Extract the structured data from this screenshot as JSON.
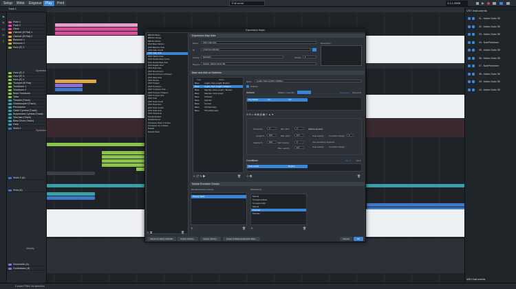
{
  "modes": [
    "Setup",
    "Write",
    "Engrave",
    "Play",
    "Print"
  ],
  "active_mode": "Play",
  "zoom": "Full score",
  "counter": "1.1.1.2908",
  "subtrack": "Track 1",
  "tools": [
    "arrow",
    "pencil",
    "eraser",
    "scissors",
    "glue"
  ],
  "tracks": [
    "Flute 1",
    "Flute 2",
    "Oboe",
    "Clarinet (B Flat) 1",
    "Clarinet (B Flat) 2",
    "Bassoon 1",
    "Bassoon 2",
    "Horn (F) 1",
    "Horn (F) 2",
    "Horn (F) 3",
    "Horn (F) 4",
    "Trumpet (B Flat)",
    "Trombone 1",
    "Trombone 2",
    "Bass Trombone",
    "Tuba",
    "Timpani (Track)",
    "Glockenspiel (Track)",
    "Percussion",
    "Clash Cymbal (Track)",
    "Suspended Cymbal (Track)",
    "Tam-tam (Track)",
    "Bass Drum (Track)",
    "Harp",
    "Violin 1",
    "Violin 2 (A)",
    "Viola (A)",
    "Violoncello (A)",
    "Contrabass (A)"
  ],
  "lane_labels": {
    "dynamics": "Dynamics",
    "velocity": "Velocity"
  },
  "right_panel": {
    "title": "VST Instruments",
    "instruments": [
      "01 - Halion Sonic SE",
      "02 - Halion Sonic SE",
      "03 - Halion Sonic SE",
      "04 - NotePerformer",
      "05 - Halion Sonic SE",
      "06 - Halion Sonic SE",
      "07 - NotePerformer",
      "08 - Halion Sonic SE",
      "09 - Halion Sonic SE",
      "10 - Halion Sonic SE"
    ],
    "footer": "MIDI Instruments"
  },
  "status": [
    "Concert Pitch",
    "No selection"
  ],
  "dialog": {
    "title": "Expression Maps",
    "map_list": [
      "BBCSO Brass",
      "BBCSO Strings",
      "BBCSO Winds",
      "HSO Bass Clarinet",
      "HSO Bassoon Solo",
      "HSO Cello Combi",
      "HSO Cello Solo",
      "HSO Clarinet Solo",
      "HSO Double Bass Combi",
      "HSO Double Bass Solo",
      "HSO English Horn",
      "HSO Flute Solo",
      "HSO French Horn",
      "HSO French Horn 4 Players",
      "HSO Oboe Solo",
      "HSO Piccolo",
      "HSO Timpani",
      "HSO Trombone",
      "HSO Trombone Solo",
      "HSO Trumpet 3 Players",
      "HSO Trumpet Solo",
      "HSO Tuba",
      "HSO Viola Combi",
      "HSO Viola Solo",
      "HSO Violin Combi",
      "HSO Violin Solo",
      "HSO Xylophone",
      "Kontakt Default",
      "NotePerformer",
      "Transpose Down 1 Octave",
      "Transpose Up 1 Octave",
      "Default",
      "Default (Solo)"
    ],
    "selected_map": "HSO Cello Solo",
    "sections": {
      "data": "Expression Map Data",
      "switches": "Base and Add-on Switches",
      "exclusion": "Mutual Exclusion Groups"
    },
    "fields": {
      "name_label": "Name",
      "name_value": "HSO Cello Solo",
      "id_label": "ID",
      "id_value": "xmap.hso.cellosolo",
      "creator_label": "Creator",
      "creator_value": "Steinberg",
      "version_label": "Version",
      "version_value": "1",
      "plugin_label": "Plug-ins",
      "plugin_value": "HALion, HALion Sonic SE",
      "desc_label": "Description"
    },
    "switch_headers": [
      "Type",
      "Name"
    ],
    "switches": [
      [
        "Base",
        "Legato, Note Length, Medium"
      ],
      [
        "Base",
        "Legato, Note Length = Medium"
      ],
      [
        "Base",
        "Staccato, Note Length = Medium"
      ],
      [
        "Base",
        "Staccato, Note Length"
      ],
      [
        "Base",
        "Pizzicato"
      ],
      [
        "Base",
        "Spiccato"
      ],
      [
        "Base",
        "Tremolo"
      ],
      [
        "Base",
        "Trill (half step)"
      ],
      [
        "Base",
        "Trill (whole step)"
      ]
    ],
    "switch_name": "Legato, Note Length = Medium",
    "enabled_label": "Enabled",
    "actions": {
      "title": "Actions",
      "mode_label": "Middle C (note 60)",
      "radio_1": "On events",
      "radio_2": "Off events",
      "ks_label": "Key Switch",
      "ks_value": "C2",
      "ks_vel": "127"
    },
    "transform": {
      "transpose_label": "Transpose",
      "transpose_value": "0",
      "min_pitch_label": "Min. pitch",
      "min_pitch_value": "0",
      "length_label": "Length %",
      "length_value": "100",
      "max_pitch_label": "Max. pitch",
      "max_pitch_value": "127",
      "velocity_label": "Velocity %",
      "velocity_value": "100",
      "min_vel_label": "Min. velocity",
      "min_vel_value": "0",
      "max_vel_label": "Max. velocity",
      "max_vel_value": "127"
    },
    "volume": {
      "title": "Volume dynamic",
      "note_vel": "Note velocity",
      "cc": "Controller change",
      "cc_value": "1",
      "vel_dyn": "Use secondary dynamics",
      "vel_label": "Note velocity",
      "ctrl_label": "Controller change"
    },
    "conditions": {
      "title": "Conditions",
      "any": "Any of",
      "all": "All of",
      "cond_label": "Note Length",
      "cond_value": "Medium"
    },
    "exclusion": {
      "left_title": "Mutual Exclusion Groups",
      "right_title": "Mechanisms",
      "left_items": [
        "Playing Styles"
      ],
      "right_items": [
        "Natural",
        "Col legno battuto",
        "Col legno tratto",
        "Natural",
        "Pizzicato",
        "Spiccato"
      ],
      "right_selected": "Pizzicato"
    },
    "footer_buttons": [
      "Reset to Library Defaults",
      "Import Library...",
      "Export Library...",
      "Import Cubase Expression Map..."
    ],
    "cancel": "Cancel",
    "ok": "OK"
  },
  "colors": {
    "accent": "#3a86d6",
    "pink": "#d64f9a",
    "green": "#8bc34a",
    "orange": "#e0a54a",
    "violet": "#8b6fd9",
    "teal": "#3aa0a8",
    "blue": "#3f77c9"
  }
}
